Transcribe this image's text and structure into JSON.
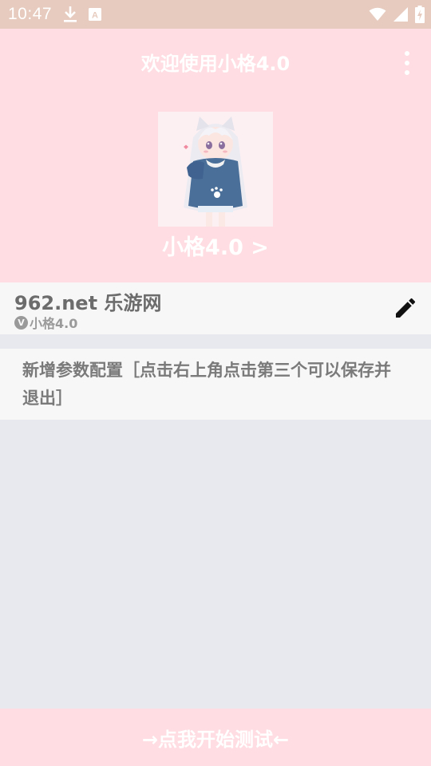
{
  "status_bar": {
    "time": "10:47",
    "icons": [
      "download-icon",
      "font-a-icon",
      "wifi-icon",
      "signal-icon",
      "battery-charging-icon"
    ],
    "badge_letter": "A"
  },
  "header": {
    "title": "欢迎使用小格4.0",
    "menu_icon": "more-vert-icon",
    "profile_name": "小格4.0 >"
  },
  "config": {
    "title": "962.net 乐游网",
    "version_badge": "V",
    "version": "小格4.0",
    "edit_icon": "pencil-icon"
  },
  "notice": {
    "text": "新增参数配置［点击右上角点击第三个可以保存并退出］"
  },
  "footer": {
    "button_label": "→点我开始测试←"
  },
  "colors": {
    "status_bar": "#e6cbbe",
    "header_bg": "#ffdde2",
    "card_bg": "#f7f7f7",
    "page_bg": "#e8e9ee"
  }
}
